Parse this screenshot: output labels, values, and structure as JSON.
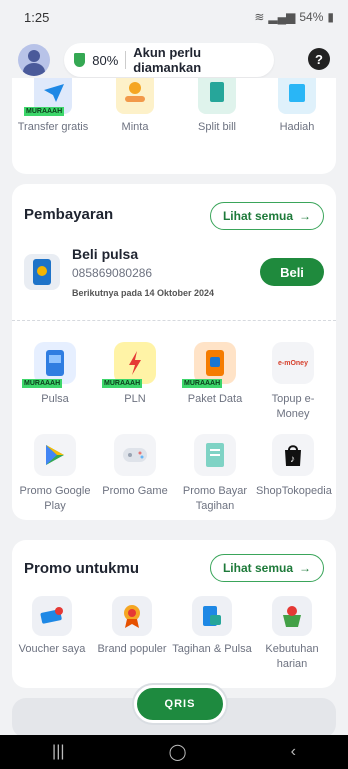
{
  "status": {
    "time": "1:25",
    "battery": "54%"
  },
  "header": {
    "security_percent": "80%",
    "security_msg": "Akun perlu diamankan",
    "help": "?"
  },
  "features": [
    {
      "label": "Transfer gratis",
      "icon": "transfer-icon",
      "tag": "MURAAAH"
    },
    {
      "label": "Minta",
      "icon": "request-icon",
      "tag": ""
    },
    {
      "label": "Split bill",
      "icon": "split-bill-icon",
      "tag": ""
    },
    {
      "label": "Hadiah",
      "icon": "gift-icon",
      "tag": ""
    }
  ],
  "payment": {
    "title": "Pembayaran",
    "see_all": "Lihat semua",
    "pulsa_title": "Beli pulsa",
    "pulsa_number": "085869080286",
    "next_date": "Berikutnya pada 14 Oktober 2024",
    "buy": "Beli",
    "grid": [
      {
        "label": "Pulsa",
        "tag": "MURAAAH",
        "icon": "pulsa-icon"
      },
      {
        "label": "PLN",
        "tag": "MURAAAH",
        "icon": "pln-icon"
      },
      {
        "label": "Paket Data",
        "tag": "MURAAAH",
        "icon": "data-package-icon"
      },
      {
        "label": "Topup e-Money",
        "tag": "",
        "icon": "emoney-icon"
      },
      {
        "label": "Promo Google Play",
        "tag": "",
        "icon": "google-play-icon"
      },
      {
        "label": "Promo Game",
        "tag": "",
        "icon": "gamepad-icon"
      },
      {
        "label": "Promo Bayar Tagihan",
        "tag": "",
        "icon": "bill-icon"
      },
      {
        "label": "ShopTokopedia",
        "tag": "",
        "icon": "tiktok-shop-icon"
      }
    ],
    "emoney_logo": "e-mOney"
  },
  "promo": {
    "title": "Promo untukmu",
    "see_all": "Lihat semua",
    "items": [
      {
        "label": "Voucher saya",
        "icon": "voucher-icon"
      },
      {
        "label": "Brand populer",
        "icon": "brand-icon"
      },
      {
        "label": "Tagihan & Pulsa",
        "icon": "bill-pulsa-icon"
      },
      {
        "label": "Kebutuhan harian",
        "icon": "daily-needs-icon"
      }
    ]
  },
  "qris_label": "QRIS",
  "colors": {
    "accent": "#1f8a3d",
    "tag": "#3dd66a"
  }
}
